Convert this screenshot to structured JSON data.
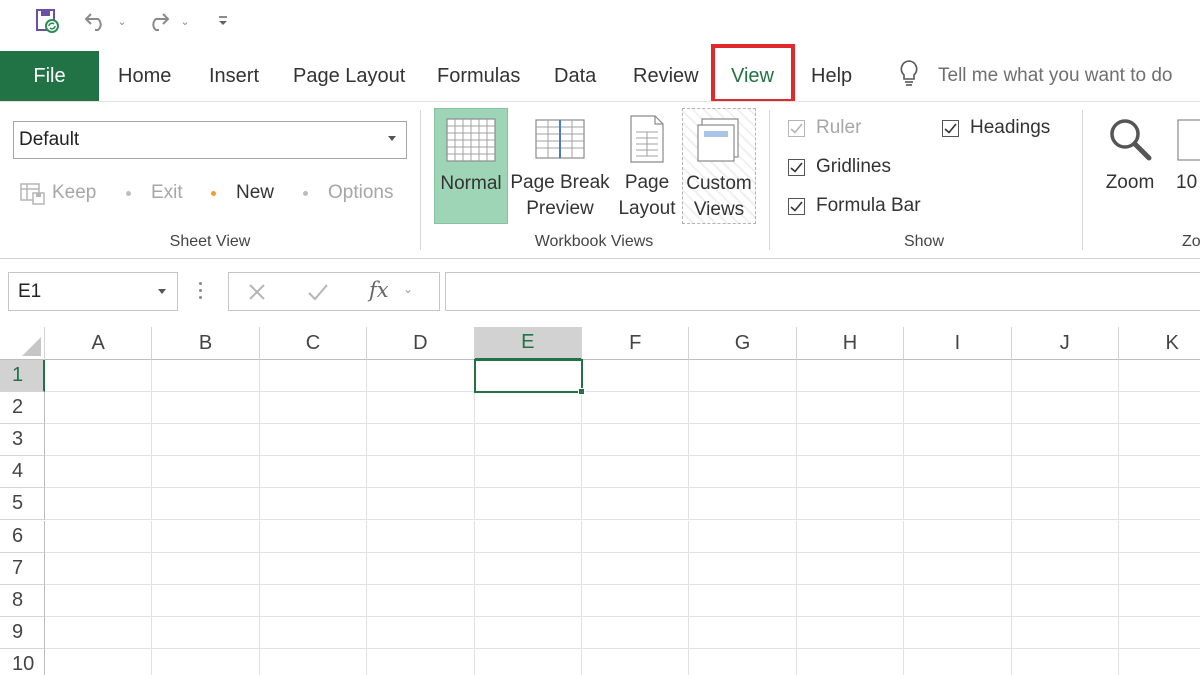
{
  "qat": {
    "icons": [
      "autosave-icon",
      "undo-icon",
      "redo-icon",
      "customize-qat-icon"
    ]
  },
  "tabs": [
    {
      "label": "File"
    },
    {
      "label": "Home"
    },
    {
      "label": "Insert"
    },
    {
      "label": "Page Layout"
    },
    {
      "label": "Formulas"
    },
    {
      "label": "Data"
    },
    {
      "label": "Review"
    },
    {
      "label": "View"
    },
    {
      "label": "Help"
    }
  ],
  "tellme": {
    "text": "Tell me what you want to do"
  },
  "ribbon": {
    "sheet_view": {
      "selected": "Default",
      "keep": "Keep",
      "exit": "Exit",
      "new": "New",
      "options": "Options",
      "group_label": "Sheet View"
    },
    "workbook_views": {
      "normal": "Normal",
      "page_break_1": "Page Break",
      "page_break_2": "Preview",
      "page_layout_1": "Page",
      "page_layout_2": "Layout",
      "custom_1": "Custom",
      "custom_2": "Views",
      "group_label": "Workbook Views"
    },
    "show": {
      "ruler": "Ruler",
      "gridlines": "Gridlines",
      "formula_bar": "Formula Bar",
      "headings": "Headings",
      "group_label": "Show"
    },
    "zoom": {
      "zoom": "Zoom",
      "hundred": "10",
      "group_label": "Zo"
    }
  },
  "formula_bar": {
    "name_box": "E1",
    "fx": "fx",
    "content": ""
  },
  "sheet": {
    "columns": [
      "A",
      "B",
      "C",
      "D",
      "E",
      "F",
      "G",
      "H",
      "I",
      "J",
      "K"
    ],
    "rows": [
      "1",
      "2",
      "3",
      "4",
      "5",
      "6",
      "7",
      "8",
      "9",
      "10"
    ],
    "active_cell": "E1"
  },
  "colors": {
    "accent": "#217346",
    "highlight": "#e0292f",
    "normal_view_bg": "#9fd5b7"
  }
}
